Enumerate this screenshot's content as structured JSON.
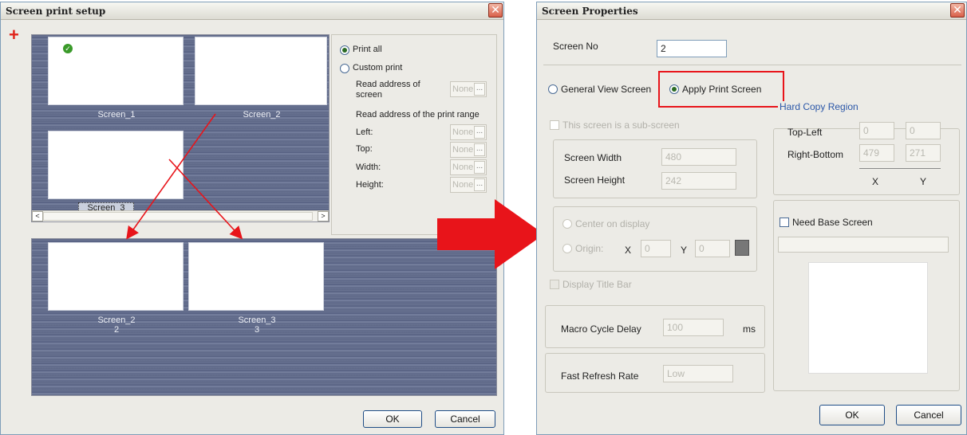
{
  "left_dialog": {
    "title": "Screen print setup",
    "top_screens": [
      {
        "label": "Screen_1"
      },
      {
        "label": "Screen_2"
      },
      {
        "label": "Screen_3"
      }
    ],
    "bottom_screens": [
      {
        "label": "Screen_2",
        "num": "2"
      },
      {
        "label": "Screen_3",
        "num": "3"
      }
    ],
    "options": {
      "print_all": "Print all",
      "custom_print": "Custom print",
      "read_address_screen": "Read address of screen",
      "read_address_range": "Read address of the print range",
      "left": "Left:",
      "top": "Top:",
      "width": "Width:",
      "height": "Height:",
      "none_value": "None"
    },
    "ok_label": "OK",
    "cancel_label": "Cancel"
  },
  "right_dialog": {
    "title": "Screen Properties",
    "screen_no_label": "Screen No",
    "screen_no_value": "2",
    "general_view_label": "General View Screen",
    "apply_print_label": "Apply Print Screen",
    "sub_screen_label": "This screen is a sub-screen",
    "screen_width_label": "Screen Width",
    "screen_width_value": "480",
    "screen_height_label": "Screen Height",
    "screen_height_value": "242",
    "center_on_display_label": "Center on display",
    "origin_label": "Origin:",
    "x_label": "X",
    "y_label": "Y",
    "origin_x": "0",
    "origin_y": "0",
    "display_title_bar_label": "Display Title Bar",
    "hard_copy_title": "Hard Copy Region",
    "top_left_label": "Top-Left",
    "top_left_x": "0",
    "top_left_y": "0",
    "right_bottom_label": "Right-Bottom",
    "right_bottom_x": "479",
    "right_bottom_y": "271",
    "col_x": "X",
    "col_y": "Y",
    "need_base_label": "Need Base Screen",
    "macro_label": "Macro Cycle Delay",
    "macro_value": "100",
    "macro_unit": "ms",
    "fast_refresh_label": "Fast Refresh Rate",
    "fast_refresh_value": "Low",
    "ok_label": "OK",
    "cancel_label": "Cancel"
  },
  "colors": {
    "annotation_red": "#e8141a",
    "checkmark_green": "#3a9a2a"
  }
}
